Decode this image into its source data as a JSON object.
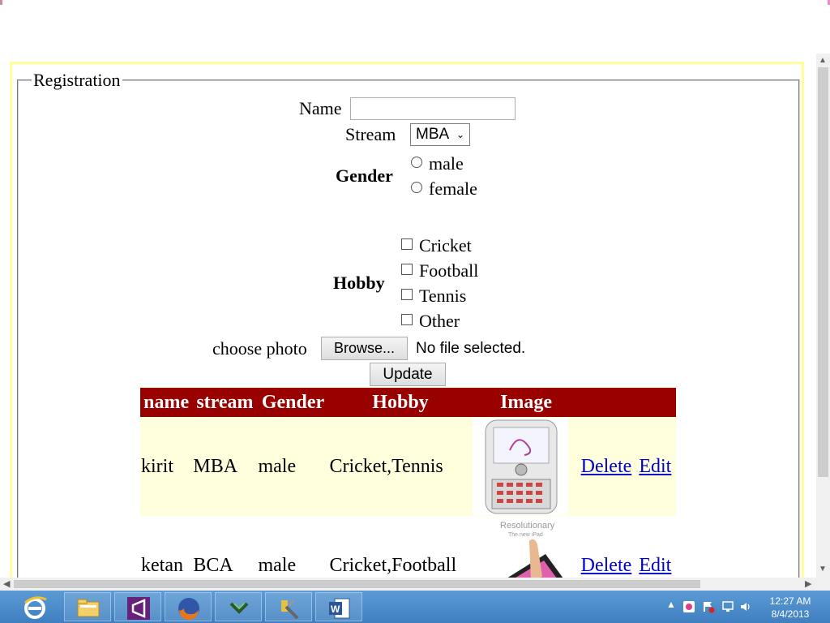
{
  "form": {
    "legend": "Registration",
    "name_label": "Name",
    "name_value": "",
    "stream_label": "Stream",
    "stream_selected": "MBA",
    "gender_label": "Gender",
    "gender_options": [
      "male",
      "female"
    ],
    "hobby_label": "Hobby",
    "hobby_options": [
      "Cricket",
      "Football",
      "Tennis",
      "Other"
    ],
    "photo_label": "choose photo",
    "browse_label": "Browse...",
    "no_file_text": "No file selected.",
    "update_label": "Update"
  },
  "table": {
    "headers": [
      "name",
      "stream",
      "Gender",
      "Hobby",
      "Image"
    ],
    "rows": [
      {
        "name": "kirit",
        "stream": "MBA",
        "gender": "male",
        "hobby": "Cricket,Tennis",
        "image": "phone-image",
        "delete": "Delete",
        "edit": "Edit"
      },
      {
        "name": "ketan",
        "stream": "BCA",
        "gender": "male",
        "hobby": "Cricket,Football",
        "image": "ipad-image",
        "image_caption": "Resolutionary\nThe new iPad",
        "delete": "Delete",
        "edit": "Edit"
      }
    ]
  },
  "taskbar": {
    "items": [
      "internet-explorer-icon",
      "file-explorer-icon",
      "visual-studio-icon",
      "firefox-icon",
      "app-icon",
      "tools-icon",
      "word-icon"
    ],
    "clock_time": "12:27 AM",
    "clock_date": "8/4/2013"
  },
  "colors": {
    "header_bg": "#990000",
    "row_alt_bg": "#ffffde",
    "frame_yellow": "#ffff99",
    "link": "#0000cc"
  }
}
